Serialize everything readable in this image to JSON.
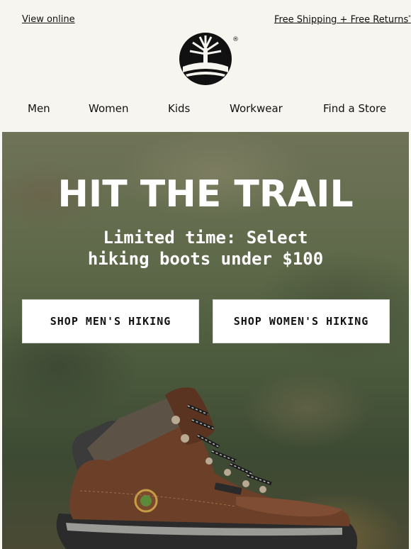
{
  "header": {
    "view_online": "View online",
    "shipping": "Free Shipping + Free Returns",
    "shipping_mark": "*",
    "logo_mark": "®"
  },
  "nav": {
    "items": [
      "Men",
      "Women",
      "Kids",
      "Workwear",
      "Find a Store"
    ]
  },
  "hero": {
    "headline": "HIT THE TRAIL",
    "subline_1": "Limited time: Select",
    "subline_2": "hiking boots under $100",
    "buttons": {
      "men": "SHOP MEN'S HIKING",
      "women": "SHOP WOMEN'S HIKING"
    }
  },
  "colors": {
    "background": "#f7f5f0",
    "text": "#111111",
    "button_bg": "#ffffff",
    "boot_leather": "#6b3f28"
  },
  "icons": {
    "logo": "tree-logo-icon",
    "product": "hiking-boot-image"
  }
}
